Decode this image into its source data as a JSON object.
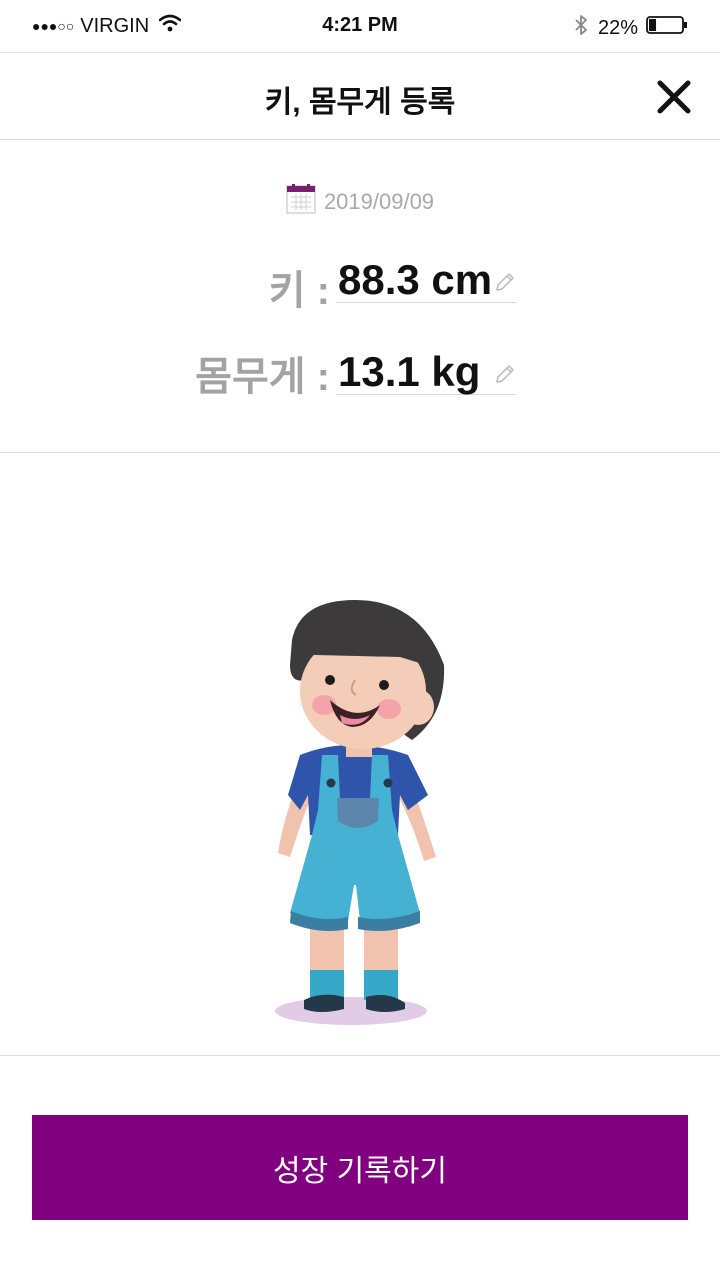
{
  "status_bar": {
    "signal": "●●●○○",
    "carrier": "VIRGIN",
    "time": "4:21 PM",
    "battery_percent": "22%",
    "battery_level": 0.22,
    "icons": [
      "wifi-icon",
      "bluetooth-icon",
      "battery-icon"
    ]
  },
  "header": {
    "title": "키, 몸무게 등록",
    "close_icon": "close-icon"
  },
  "record": {
    "date": "2019/09/09",
    "calendar_icon": "calendar-icon",
    "height_label": "키 :",
    "height_value": "88.3 cm",
    "weight_label": "몸무게 :",
    "weight_value": "13.1 kg",
    "edit_icon": "pencil-icon"
  },
  "cta": {
    "label": "성장 기록하기"
  },
  "colors": {
    "accent": "#800080",
    "label_gray": "#a3a3a3",
    "date_gray": "#a9a9a9"
  }
}
